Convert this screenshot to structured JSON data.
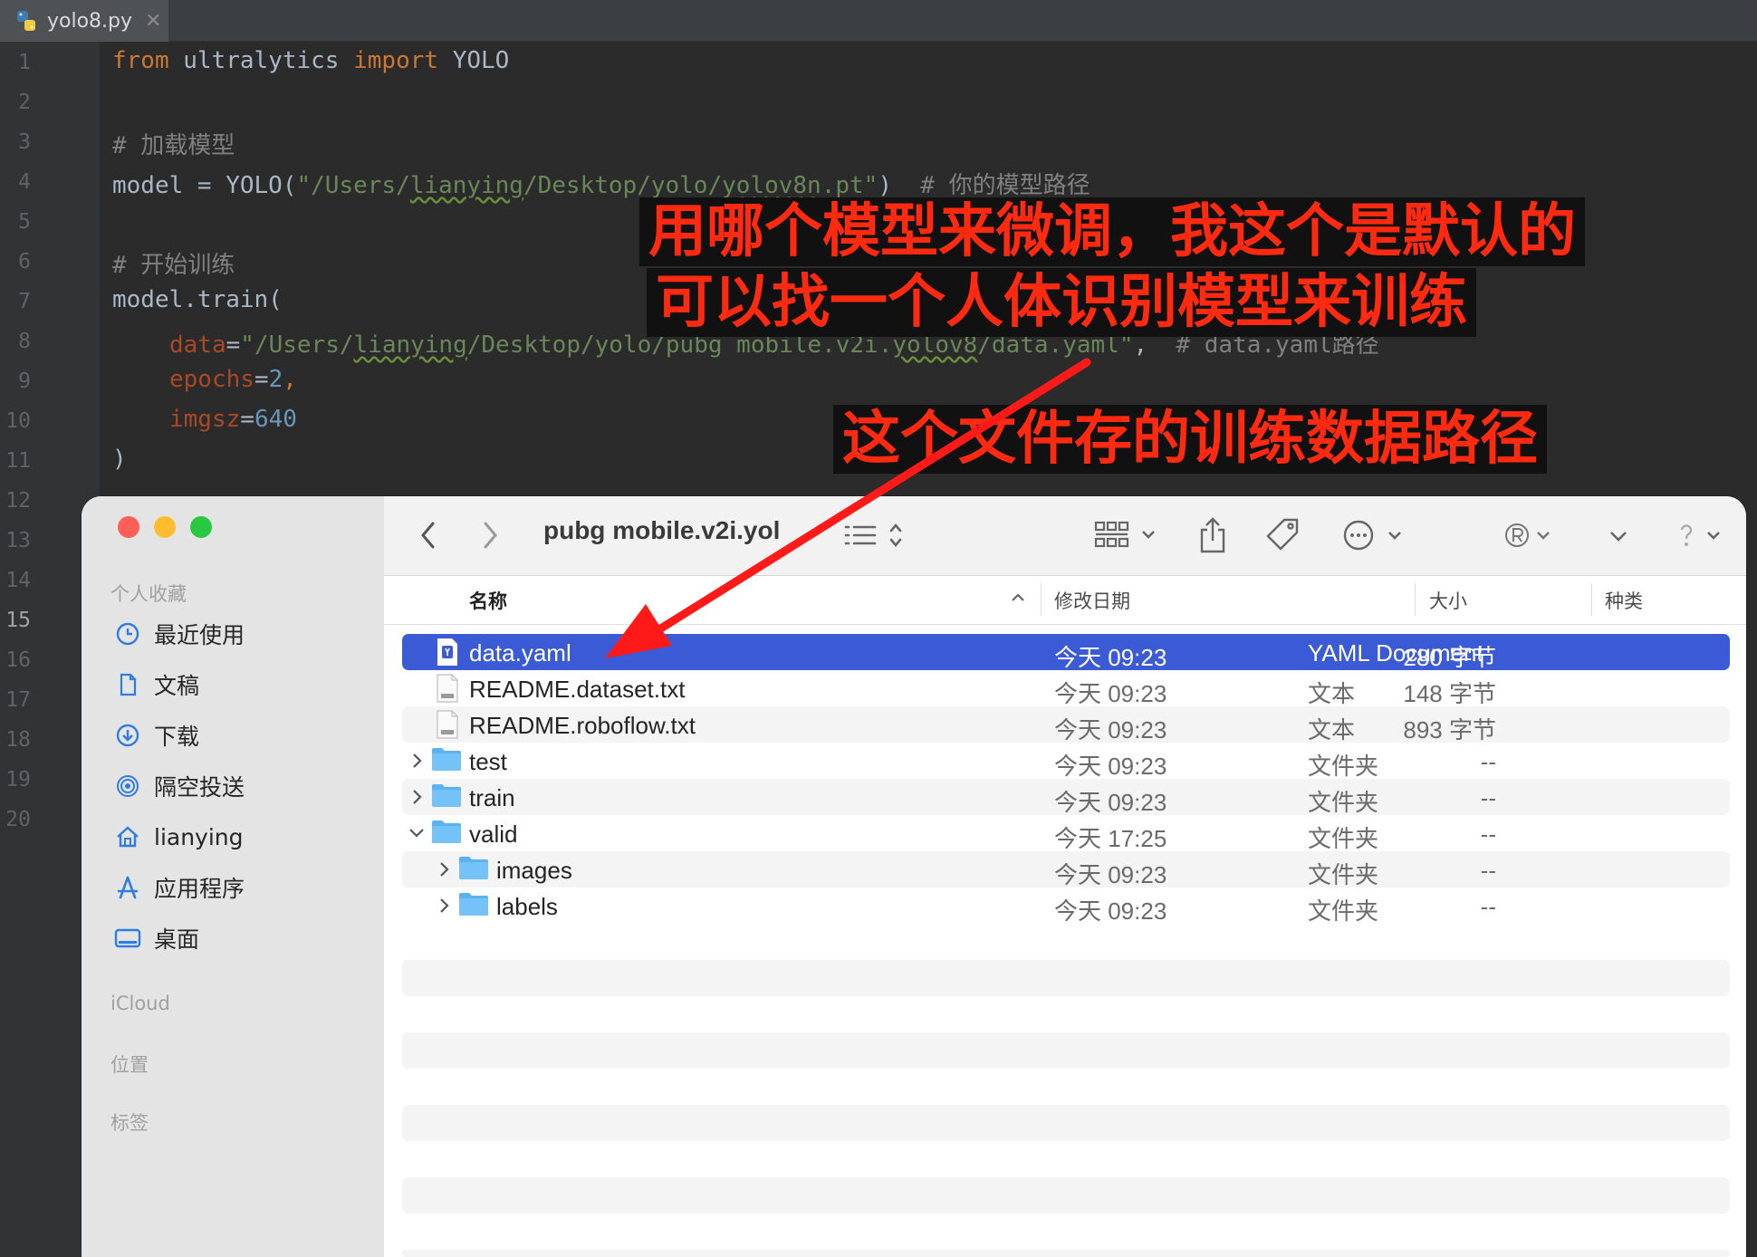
{
  "ide": {
    "tab_label": "yolo8.py",
    "tab_close": "✕",
    "line_numbers": [
      "1",
      "2",
      "3",
      "4",
      "5",
      "6",
      "7",
      "8",
      "9",
      "10",
      "11",
      "12",
      "13",
      "14",
      "15",
      "16",
      "17",
      "18",
      "19",
      "20"
    ],
    "code": {
      "l1_from": "from",
      "l1_module": " ultralytics ",
      "l1_import": "import",
      "l1_name": " YOLO",
      "l3_comment": "# 加载模型",
      "l4_a": "model = YOLO(",
      "l4_s1": "\"/Users/",
      "l4_s2": "lianying",
      "l4_s3": "/Desktop/yolo/",
      "l4_s4": "yolov8n",
      "l4_s5": ".pt\"",
      "l4_b": ")  ",
      "l4_comment": "# 你的模型路径",
      "l6_comment": "# 开始训练",
      "l7": "model.train(",
      "l8_param": "data",
      "l8_eq": "=",
      "l8_s1": "\"/Users/",
      "l8_s2": "lianying",
      "l8_s3": "/Desktop/yolo/pubg mobile.v2i.",
      "l8_s4": "yolov8",
      "l8_s5": "/data.yaml\"",
      "l8_c": ",  ",
      "l8_comment": "# data.yaml路径",
      "l9_param": "epochs",
      "l9_eq": "=",
      "l9_val": "2",
      "l9_c": ",",
      "l10_param": "imgsz",
      "l10_eq": "=",
      "l10_val": "640",
      "l11": ")"
    }
  },
  "finder": {
    "title": "pubg mobile.v2i.yol",
    "sidebar": {
      "favorites_header": "个人收藏",
      "items": [
        {
          "label": "最近使用",
          "icon": "clock-icon"
        },
        {
          "label": "文稿",
          "icon": "document-icon"
        },
        {
          "label": "下载",
          "icon": "download-icon"
        },
        {
          "label": "隔空投送",
          "icon": "airdrop-icon"
        },
        {
          "label": "lianying",
          "icon": "home-icon"
        },
        {
          "label": "应用程序",
          "icon": "applications-icon"
        },
        {
          "label": "桌面",
          "icon": "desktop-icon"
        }
      ],
      "icloud_header": "iCloud",
      "locations_header": "位置",
      "tags_header": "标签"
    },
    "columns": {
      "name": "名称",
      "date": "修改日期",
      "size": "大小",
      "kind": "种类"
    },
    "rows": [
      {
        "name": "data.yaml",
        "date": "今天 09:23",
        "size": "280 字节",
        "kind": "YAML Document",
        "type": "yaml",
        "selected": true
      },
      {
        "name": "README.dataset.txt",
        "date": "今天 09:23",
        "size": "148 字节",
        "kind": "文本",
        "type": "txt"
      },
      {
        "name": "README.roboflow.txt",
        "date": "今天 09:23",
        "size": "893 字节",
        "kind": "文本",
        "type": "txt"
      },
      {
        "name": "test",
        "date": "今天 09:23",
        "size": "--",
        "kind": "文件夹",
        "type": "folder",
        "disclosure": "collapsed"
      },
      {
        "name": "train",
        "date": "今天 09:23",
        "size": "--",
        "kind": "文件夹",
        "type": "folder",
        "disclosure": "collapsed"
      },
      {
        "name": "valid",
        "date": "今天 17:25",
        "size": "--",
        "kind": "文件夹",
        "type": "folder",
        "disclosure": "expanded"
      },
      {
        "name": "images",
        "date": "今天 09:23",
        "size": "--",
        "kind": "文件夹",
        "type": "folder",
        "disclosure": "collapsed",
        "child": true
      },
      {
        "name": "labels",
        "date": "今天 09:23",
        "size": "--",
        "kind": "文件夹",
        "type": "folder",
        "disclosure": "collapsed",
        "child": true
      }
    ]
  },
  "annotations": {
    "line1": "用哪个模型来微调，我这个是默认的",
    "line2": "可以找一个人体识别模型来训练",
    "line3": "这个文件存的训练数据路径",
    "text_color": "#ff2a10",
    "arrow_color": "#ff1a1a"
  },
  "colors": {
    "editor_bg": "#2b2b2b",
    "keyword": "#cc7832",
    "string": "#6a8759",
    "comment": "#808080",
    "number": "#6897bb",
    "selection": "#3b5bd6"
  }
}
